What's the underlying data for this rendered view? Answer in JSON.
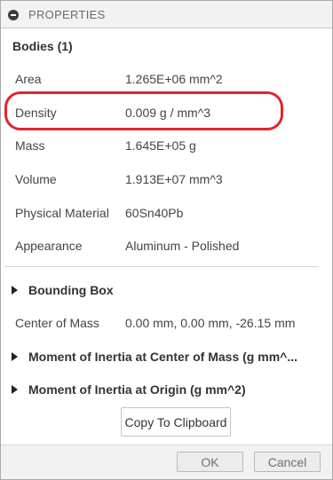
{
  "panel": {
    "title": "PROPERTIES",
    "group_title": "Bodies (1)"
  },
  "properties": [
    {
      "label": "Area",
      "value": "1.265E+06 mm^2"
    },
    {
      "label": "Density",
      "value": "0.009 g / mm^3"
    },
    {
      "label": "Mass",
      "value": "1.645E+05 g"
    },
    {
      "label": "Volume",
      "value": "1.913E+07 mm^3"
    },
    {
      "label": "Physical Material",
      "value": "60Sn40Pb"
    },
    {
      "label": "Appearance",
      "value": "Aluminum - Polished"
    }
  ],
  "sections": {
    "bounding_box": "Bounding Box",
    "center_of_mass_label": "Center of Mass",
    "center_of_mass_value": "0.00 mm, 0.00 mm, -26.15 mm",
    "inertia_center": "Moment of Inertia at Center of Mass   (g mm^...",
    "inertia_origin": "Moment of Inertia at Origin   (g mm^2)"
  },
  "buttons": {
    "copy": "Copy To Clipboard",
    "ok": "OK",
    "cancel": "Cancel"
  },
  "colors": {
    "highlight": "#e0262b"
  }
}
